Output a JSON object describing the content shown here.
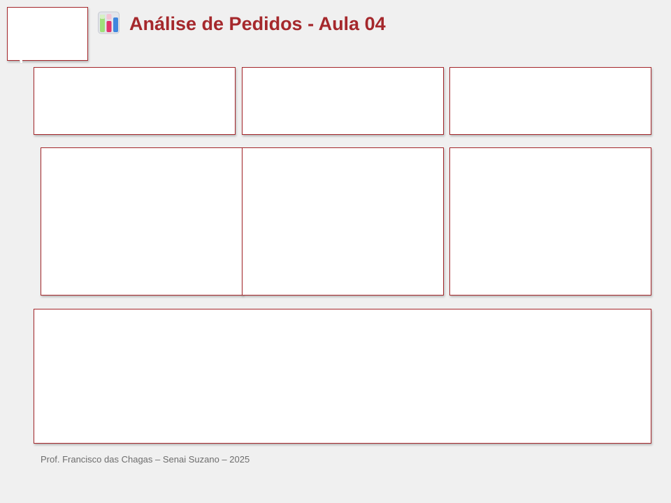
{
  "header": {
    "title": "Análise de Pedidos - Aula 04",
    "title_icon": "bar-chart-icon"
  },
  "footer": {
    "credit": "Prof. Francisco das Chagas – Senai Suzano – 2025"
  },
  "colors": {
    "background": "#f0f0f0",
    "accent": "#a5282c",
    "card": "#ffffff"
  }
}
